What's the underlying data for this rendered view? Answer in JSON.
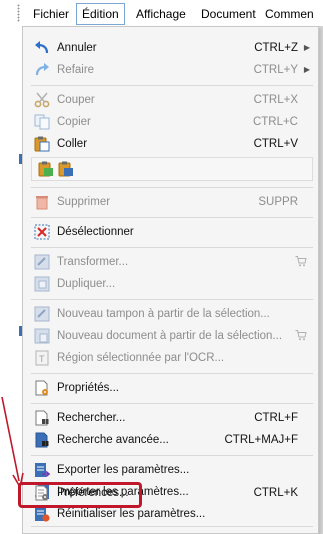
{
  "menubar": {
    "items": [
      "Fichier",
      "Édition",
      "Affichage",
      "Document",
      "Commen"
    ],
    "active": "Édition"
  },
  "menu": {
    "undo": {
      "label": "Annuler",
      "shortcut": "CTRL+Z",
      "icon": "undo-icon"
    },
    "redo": {
      "label": "Refaire",
      "shortcut": "CTRL+Y",
      "icon": "redo-icon"
    },
    "cut": {
      "label": "Couper",
      "shortcut": "CTRL+X",
      "icon": "scissors-icon"
    },
    "copy": {
      "label": "Copier",
      "shortcut": "CTRL+C",
      "icon": "copy-icon"
    },
    "paste": {
      "label": "Coller",
      "shortcut": "CTRL+V",
      "icon": "clipboard-icon"
    },
    "delete": {
      "label": "Supprimer",
      "shortcut": "SUPPR",
      "icon": "trash-icon"
    },
    "deselect": {
      "label": "Désélectionner",
      "icon": "deselect-icon"
    },
    "transform": {
      "label": "Transformer...",
      "icon": "transform-icon"
    },
    "duplicate": {
      "label": "Dupliquer...",
      "icon": "duplicate-icon"
    },
    "new_stamp": {
      "label": "Nouveau tampon à partir de la sélection...",
      "icon": "stamp-icon"
    },
    "new_document": {
      "label": "Nouveau document à partir de la sélection...",
      "icon": "new-document-icon"
    },
    "ocr_region": {
      "label": "Région sélectionnée par l'OCR...",
      "icon": "ocr-icon"
    },
    "properties": {
      "label": "Propriétés...",
      "icon": "properties-icon"
    },
    "search": {
      "label": "Rechercher...",
      "shortcut": "CTRL+F",
      "icon": "search-icon"
    },
    "advanced_search": {
      "label": "Recherche avancée...",
      "shortcut": "CTRL+MAJ+F",
      "icon": "advanced-search-icon"
    },
    "export_settings": {
      "label": "Exporter les paramètres...",
      "icon": "export-icon"
    },
    "import_settings": {
      "label": "Importer les paramètres...",
      "icon": "import-icon"
    },
    "reset_settings": {
      "label": "Réinitialiser les paramètres...",
      "icon": "reset-icon"
    },
    "preferences": {
      "label": "Préférences...",
      "shortcut": "CTRL+K",
      "icon": "preferences-icon"
    }
  },
  "colors": {
    "highlight": "#c0182a",
    "accent": "#3b6fb6",
    "disabled_text": "#8d8d8d"
  }
}
